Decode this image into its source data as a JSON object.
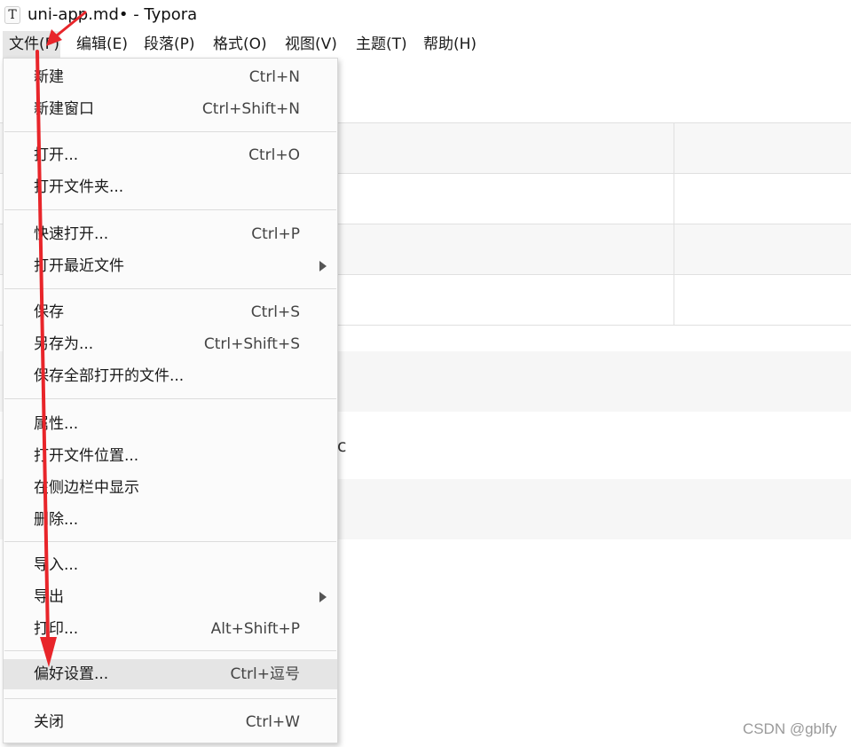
{
  "window": {
    "title": "uni-app.md• - Typora",
    "app_icon_glyph": "T"
  },
  "menubar": [
    {
      "label": "文件(F)"
    },
    {
      "label": "编辑(E)"
    },
    {
      "label": "段落(P)"
    },
    {
      "label": "格式(O)"
    },
    {
      "label": "视图(V)"
    },
    {
      "label": "主题(T)"
    },
    {
      "label": "帮助(H)"
    }
  ],
  "file_menu": {
    "items": [
      {
        "label": "新建",
        "shortcut": "Ctrl+N"
      },
      {
        "label": "新建窗口",
        "shortcut": "Ctrl+Shift+N"
      },
      {
        "label": "打开...",
        "shortcut": "Ctrl+O"
      },
      {
        "label": "打开文件夹...",
        "shortcut": ""
      },
      {
        "label": "快速打开...",
        "shortcut": "Ctrl+P"
      },
      {
        "label": "打开最近文件",
        "shortcut": "",
        "submenu": true
      },
      {
        "label": "保存",
        "shortcut": "Ctrl+S"
      },
      {
        "label": "另存为...",
        "shortcut": "Ctrl+Shift+S"
      },
      {
        "label": "保存全部打开的文件...",
        "shortcut": ""
      },
      {
        "label": "属性...",
        "shortcut": ""
      },
      {
        "label": "打开文件位置...",
        "shortcut": ""
      },
      {
        "label": "在侧边栏中显示",
        "shortcut": ""
      },
      {
        "label": "删除...",
        "shortcut": ""
      },
      {
        "label": "导入...",
        "shortcut": ""
      },
      {
        "label": "导出",
        "shortcut": "",
        "submenu": true
      },
      {
        "label": "打印...",
        "shortcut": "Alt+Shift+P"
      },
      {
        "label": "偏好设置...",
        "shortcut": "Ctrl+逗号",
        "highlighted": true
      },
      {
        "label": "关闭",
        "shortcut": "Ctrl+W"
      }
    ]
  },
  "document": {
    "visible_fragment": "c"
  },
  "watermark": "CSDN @gblfy",
  "colors": {
    "annotation_arrow": "#e8252a",
    "highlight": "#e5e5e5",
    "menu_bg": "#fbfbfb"
  },
  "icons": {
    "submenu": "chevron-right-icon"
  }
}
